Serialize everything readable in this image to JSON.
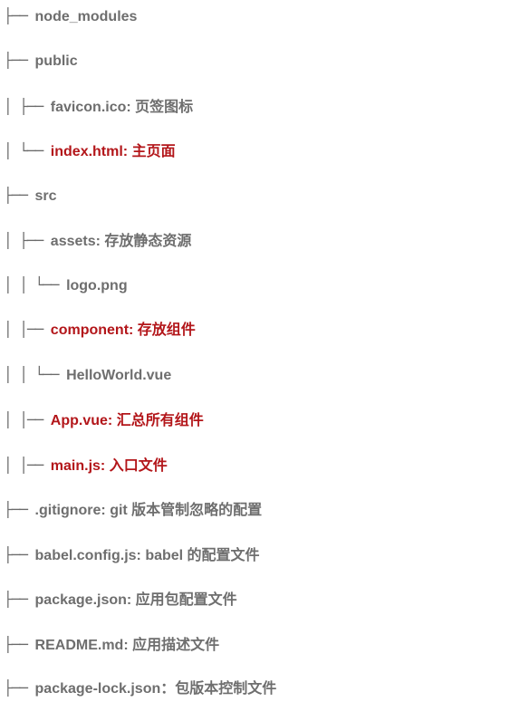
{
  "tree": {
    "highlight_color": "#b3161a",
    "text_color": "#6e6e6e",
    "rows": [
      {
        "prefix": "├── ",
        "label": "node_modules",
        "highlight": false
      },
      {
        "prefix": "├── ",
        "label": "public",
        "highlight": false
      },
      {
        "prefix": "│   ├── ",
        "label": "favicon.ico: 页签图标",
        "highlight": false
      },
      {
        "prefix": "│   └── ",
        "label": "index.html: 主页面",
        "highlight": true
      },
      {
        "prefix": "├── ",
        "label": "src",
        "highlight": false
      },
      {
        "prefix": "│   ├── ",
        "label": "assets: 存放静态资源",
        "highlight": false
      },
      {
        "prefix": "│   │   └── ",
        "label": "logo.png",
        "highlight": false
      },
      {
        "prefix": "│   │── ",
        "label": "component: 存放组件",
        "highlight": true
      },
      {
        "prefix": "│   │   └── ",
        "label": "HelloWorld.vue",
        "highlight": false
      },
      {
        "prefix": "│   │── ",
        "label": "App.vue: 汇总所有组件",
        "highlight": true
      },
      {
        "prefix": "│   │── ",
        "label": "main.js: 入口文件",
        "highlight": true
      },
      {
        "prefix": "├── ",
        "label": ".gitignore: git 版本管制忽略的配置",
        "highlight": false
      },
      {
        "prefix": "├── ",
        "label": "babel.config.js: babel 的配置文件",
        "highlight": false
      },
      {
        "prefix": "├── ",
        "label": "package.json: 应用包配置文件",
        "highlight": false
      },
      {
        "prefix": "├── ",
        "label": "README.md: 应用描述文件",
        "highlight": false
      },
      {
        "prefix": "├── ",
        "label": "package-lock.json：包版本控制文件",
        "highlight": false
      }
    ]
  }
}
